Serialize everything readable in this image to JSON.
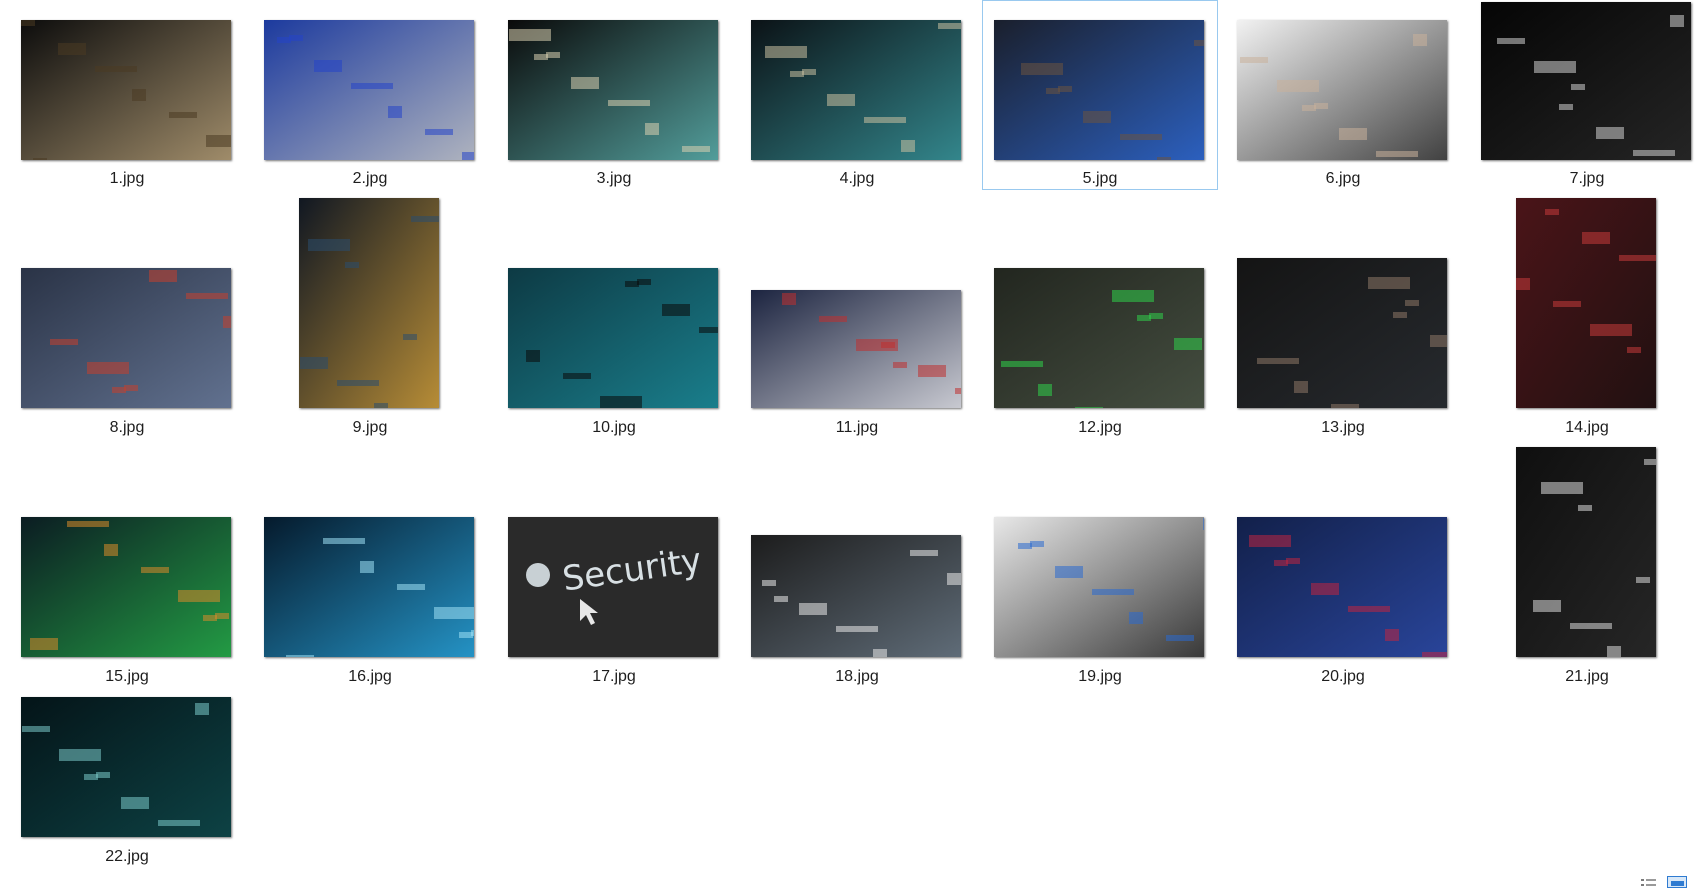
{
  "files": [
    {
      "name": "1.jpg",
      "theme": "switch-ports",
      "colors": [
        "#0c0c0c",
        "#b9a27a",
        "#4a3b22"
      ]
    },
    {
      "name": "2.jpg",
      "theme": "blue-ethernet-cables",
      "colors": [
        "#1c3a9e",
        "#c8c8c4",
        "#2444c8"
      ]
    },
    {
      "name": "3.jpg",
      "theme": "fiber-patch-panel",
      "colors": [
        "#0a0a0a",
        "#5fb7b4",
        "#d8d0b0"
      ]
    },
    {
      "name": "4.jpg",
      "theme": "fiber-cables-teal",
      "colors": [
        "#0b1216",
        "#3a9aa0",
        "#c9c0a0"
      ]
    },
    {
      "name": "5.jpg",
      "theme": "datacenter-person",
      "colors": [
        "#1a1f2c",
        "#2f6bd8",
        "#6b5440"
      ]
    },
    {
      "name": "6.jpg",
      "theme": "workstation-laptop",
      "colors": [
        "#f2f2f2",
        "#222222",
        "#c9b09a"
      ]
    },
    {
      "name": "7.jpg",
      "theme": "dark-keyboard",
      "colors": [
        "#050505",
        "#2a2a2a",
        "#d0d0d0"
      ]
    },
    {
      "name": "8.jpg",
      "theme": "circuit-board",
      "colors": [
        "#2a3346",
        "#6b7c9c",
        "#c4402e"
      ]
    },
    {
      "name": "9.jpg",
      "theme": "server-rack-cables",
      "colors": [
        "#101722",
        "#d4a13a",
        "#2a4c6e"
      ]
    },
    {
      "name": "10.jpg",
      "theme": "desk-monitors",
      "colors": [
        "#0d3a44",
        "#1c8a98",
        "#0a0a0a"
      ]
    },
    {
      "name": "11.jpg",
      "theme": "ethernet-plugs",
      "colors": [
        "#1c2440",
        "#e6e6ea",
        "#c03030"
      ]
    },
    {
      "name": "12.jpg",
      "theme": "green-keyboard",
      "colors": [
        "#22261f",
        "#4b5546",
        "#2fd04a"
      ]
    },
    {
      "name": "13.jpg",
      "theme": "hooded-hacker-monitor",
      "colors": [
        "#141414",
        "#2a2e33",
        "#8c7766"
      ]
    },
    {
      "name": "14.jpg",
      "theme": "scattered-keys-red",
      "colors": [
        "#4a1418",
        "#1a1010",
        "#c43a3a"
      ]
    },
    {
      "name": "15.jpg",
      "theme": "hacker-green-code",
      "colors": [
        "#0b1c22",
        "#27b14a",
        "#d98a2a"
      ]
    },
    {
      "name": "16.jpg",
      "theme": "blue-server-drives",
      "colors": [
        "#051a2c",
        "#2aa8e0",
        "#9fe0f4"
      ]
    },
    {
      "name": "17.jpg",
      "theme": "security-text",
      "colors": [
        "#2a2a2a",
        "#d8e0e4",
        "#111111"
      ]
    },
    {
      "name": "18.jpg",
      "theme": "operations-center",
      "colors": [
        "#1c1c1c",
        "#6b7a88",
        "#e8e8e8"
      ]
    },
    {
      "name": "19.jpg",
      "theme": "electrical-panel",
      "colors": [
        "#e8e8e8",
        "#1a1a1a",
        "#2a6ad0"
      ]
    },
    {
      "name": "20.jpg",
      "theme": "hands-on-keyboard-blue",
      "colors": [
        "#12204a",
        "#2d4ba8",
        "#c02440"
      ]
    },
    {
      "name": "21.jpg",
      "theme": "masked-person",
      "colors": [
        "#0f0f0f",
        "#2a2a2a",
        "#d8d8d8"
      ]
    },
    {
      "name": "22.jpg",
      "theme": "binary-code-hand",
      "colors": [
        "#041418",
        "#0f4a4c",
        "#7ac8c8"
      ]
    }
  ],
  "selected_file": "5.jpg",
  "view_mode_icons": [
    "details-view-icon",
    "large-icons-view-icon"
  ]
}
